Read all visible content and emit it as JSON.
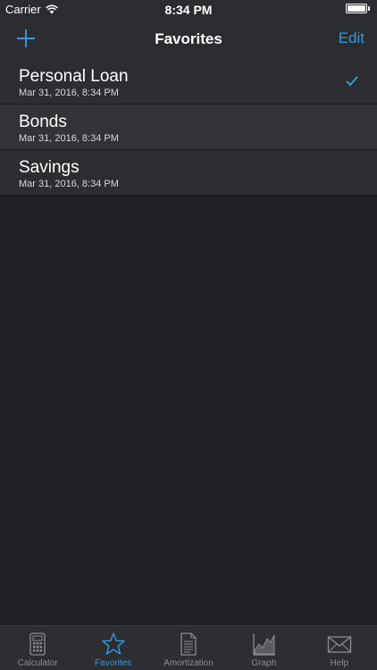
{
  "status_bar": {
    "carrier": "Carrier",
    "time": "8:34 PM"
  },
  "nav": {
    "title": "Favorites",
    "edit_label": "Edit",
    "add_icon": "plus-icon"
  },
  "favorites": [
    {
      "title": "Personal Loan",
      "date": "Mar 31, 2016, 8:34 PM",
      "selected": true
    },
    {
      "title": "Bonds",
      "date": "Mar 31, 2016, 8:34 PM",
      "selected": false
    },
    {
      "title": "Savings",
      "date": "Mar 31, 2016, 8:34 PM",
      "selected": false
    }
  ],
  "tabs": [
    {
      "label": "Calculator",
      "icon": "calculator-icon",
      "active": false
    },
    {
      "label": "Favorites",
      "icon": "star-icon",
      "active": true
    },
    {
      "label": "Amortization",
      "icon": "document-icon",
      "active": false
    },
    {
      "label": "Graph",
      "icon": "graph-icon",
      "active": false
    },
    {
      "label": "Help",
      "icon": "envelope-icon",
      "active": false
    }
  ],
  "colors": {
    "accent": "#2f9ae0",
    "background": "#1f2124",
    "bar": "#2a2c2f"
  }
}
